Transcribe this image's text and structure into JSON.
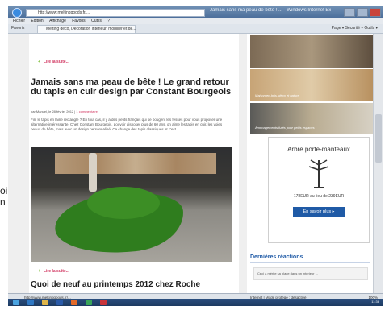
{
  "left_fragments": {
    "line1": "oi",
    "line2": "n"
  },
  "browser": {
    "window_title": "Jamais sans ma peau de bête ! ... - Windows Internet Explorer",
    "address": "http://www.meltinggoods.fr/...",
    "menu": [
      "Fichier",
      "Edition",
      "Affichage",
      "Favoris",
      "Outils",
      "?"
    ],
    "favorites_label": "Favoris",
    "tab_label": "Melting déco, Décoration intérieur, mobilier et dé...",
    "toolbar_right": "Page ▾  Sécurité ▾  Outils ▾"
  },
  "article": {
    "read_more_top": "Lire la suite...",
    "title": "Jamais sans ma peau de bête ! Le grand retour du tapis en cuir design par Constant Bourgeois",
    "meta_prefix": "par Manuel, le 28 février 2012 |",
    "meta_link": "1 commentaire",
    "excerpt": "Fini le tapis en laine rectangle ? En tout cas, il y a des petits français qui se bougent les fesses pour vous proposer une alternative intéressante. Chez Constant Bourgeois, pouvoir disposer plus de 60 ans, on aime les tapis en cuir, les voies peaux de bête, mais avec un design personnalisé. Ca change des tapis classiques et c'est...",
    "read_more_bottom": "Lire la suite...",
    "next_title": "Quoi de neuf au printemps 2012 chez Roche"
  },
  "sidebar": {
    "captions": [
      "Maison en bois, déco et nature",
      "",
      "Aménagements futés pour petits espaces"
    ],
    "ad_title": "Arbre porte-manteaux",
    "ad_price": "178EUR au lieu de 239EUR",
    "ad_button": "En savoir plus",
    "reactions_title": "Dernières réactions",
    "reaction_text": "Ceci a mérite sa place dans un intérieur ..."
  },
  "status": {
    "left_text": "http://www.meltinggoods.fr/...",
    "mid_text": "Internet | Mode protégé : désactivé",
    "zoom": "100%",
    "clock": "11:36"
  }
}
